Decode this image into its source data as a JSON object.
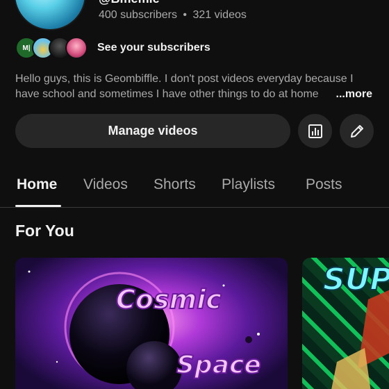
{
  "channel": {
    "handle": "@Bmemie",
    "subscribers": "400 subscribers",
    "videos": "321 videos",
    "separator": "•",
    "see_subscribers": "See your subscribers",
    "description_line1": "Hello guys, this is Geombiffle. I don't post videos everyday because I",
    "description_line2": "have school and sometimes I have other things to do at home",
    "more_label": "...more",
    "mini_avatar_text": "M|"
  },
  "actions": {
    "manage_videos": "Manage videos",
    "analytics_icon": "analytics-icon",
    "edit_icon": "pencil-icon"
  },
  "tabs": [
    {
      "label": "Home",
      "active": true
    },
    {
      "label": "Videos",
      "active": false
    },
    {
      "label": "Shorts",
      "active": false
    },
    {
      "label": "Playlists",
      "active": false
    },
    {
      "label": "Posts",
      "active": false
    }
  ],
  "section": {
    "title": "For You"
  },
  "videos": [
    {
      "title_line1": "Cosmic",
      "title_line2": "Space"
    },
    {
      "title_partial": "SUP"
    }
  ],
  "colors": {
    "background": "#0f0f0f",
    "surface": "#272727",
    "text_primary": "#f1f1f1",
    "text_secondary": "#aaaaaa"
  }
}
